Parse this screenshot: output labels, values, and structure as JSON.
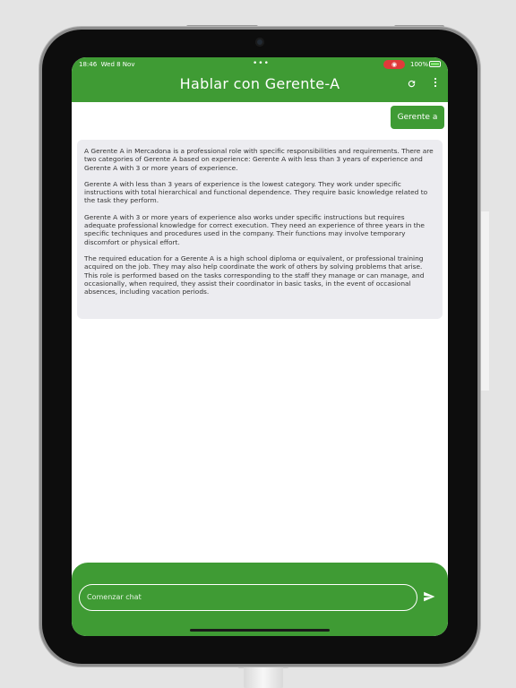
{
  "status": {
    "time": "18:46",
    "date": "Wed 8 Nov",
    "dots": "•••",
    "battery": "100%"
  },
  "header": {
    "title": "Hablar con Gerente-A",
    "refresh_icon": "refresh-icon",
    "menu_icon": "more-vert-icon"
  },
  "chat": {
    "user_message": "Gerente a",
    "bot_paragraphs": [
      "A Gerente A in Mercadona is a professional role with specific responsibilities and requirements. There are two categories of Gerente A based on experience: Gerente A with less than 3 years of experience and Gerente A with 3 or more years of experience.",
      "Gerente A with less than 3 years of experience is the lowest category. They work under specific instructions with total hierarchical and functional dependence. They require basic knowledge related to the task they perform.",
      "Gerente A with 3 or more years of experience also works under specific instructions but requires adequate professional knowledge for correct execution. They need an experience of three years in the specific techniques and procedures used in the company. Their functions may involve temporary discomfort or physical effort.",
      "The required education for a Gerente A is a high school diploma or equivalent, or professional training acquired on the job. They may also help coordinate the work of others by solving problems that arise. This role is performed based on the tasks corresponding to the staff they manage or can manage, and occasionally, when required, they assist their coordinator in basic tasks, in the event of occasional absences, including vacation periods."
    ]
  },
  "composer": {
    "placeholder": "Comenzar chat",
    "send_icon": "send-icon"
  },
  "colors": {
    "brand_green": "#3f9b34",
    "bubble_bg": "#ececf0"
  }
}
